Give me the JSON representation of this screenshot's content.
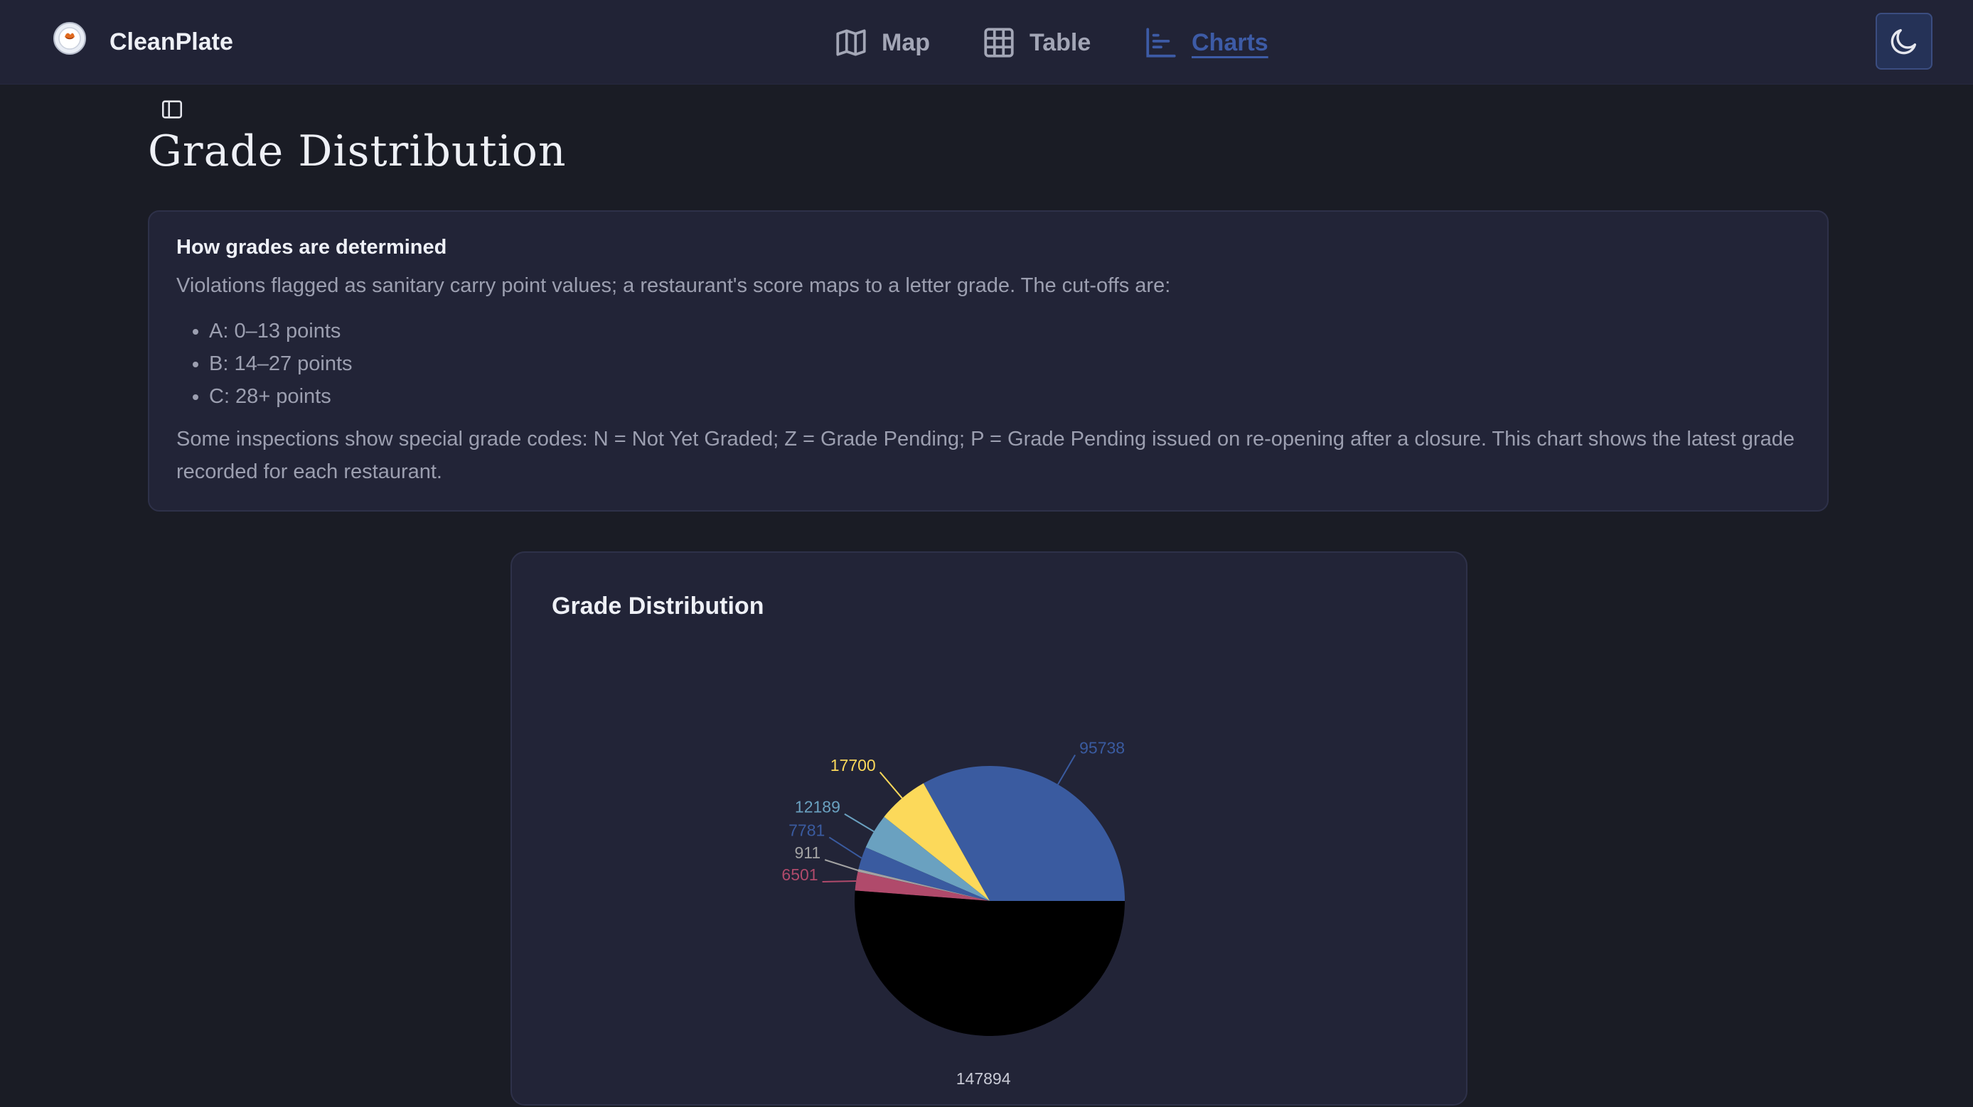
{
  "app": {
    "name": "CleanPlate"
  },
  "nav": {
    "items": [
      {
        "label": "Map",
        "icon": "map-icon",
        "active": false
      },
      {
        "label": "Table",
        "icon": "table-icon",
        "active": false
      },
      {
        "label": "Charts",
        "icon": "chart-icon",
        "active": true
      }
    ],
    "theme_icon": "moon-icon"
  },
  "page": {
    "title": "Grade Distribution"
  },
  "info": {
    "heading": "How grades are determined",
    "intro": "Violations flagged as sanitary carry point values; a restaurant's score maps to a letter grade. The cut-offs are:",
    "cutoffs": [
      "A: 0–13 points",
      "B: 14–27 points",
      "C: 28+ points"
    ],
    "note": "Some inspections show special grade codes: N = Not Yet Graded; Z = Grade Pending; P = Grade Pending issued on re-opening after a closure. This chart shows the latest grade recorded for each restaurant."
  },
  "colors": {
    "accent": "#3d5ba6",
    "background": "#1a1c25",
    "panel": "#222437"
  },
  "chart_data": {
    "type": "pie",
    "title": "Grade Distribution",
    "slices": [
      {
        "value": 95738,
        "color": "#3a5ba0"
      },
      {
        "value": 17700,
        "color": "#fcd95a"
      },
      {
        "value": 12189,
        "color": "#6aa1c0"
      },
      {
        "value": 7781,
        "color": "#3a5ba0"
      },
      {
        "value": 911,
        "color": "#a3a3a3"
      },
      {
        "value": 6501,
        "color": "#b04a6b"
      },
      {
        "value": 147894,
        "color": "#000000"
      }
    ]
  }
}
